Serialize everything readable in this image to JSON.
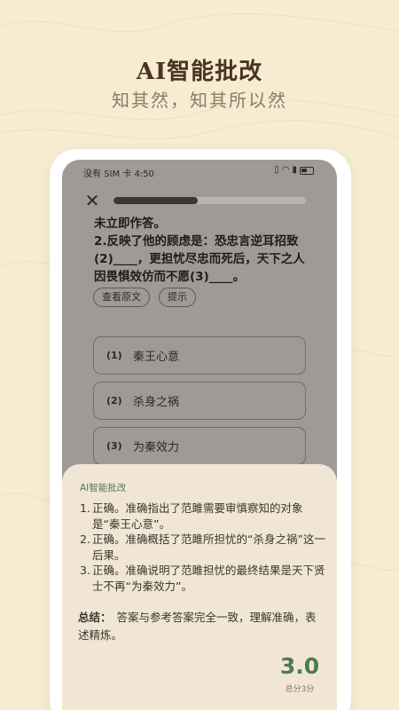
{
  "promo": {
    "title": "AI智能批改",
    "subtitle": "知其然，知其所以然"
  },
  "status_bar": {
    "left": "没有 SIM 卡 4:50",
    "icons": [
      "vibrate-icon",
      "wifi-icon",
      "battery-saver-icon",
      "battery-icon"
    ]
  },
  "quiz": {
    "progress_fraction": 0.44,
    "question_text": "未立即作答。\n2.反映了他的顾虑是：恐忠言逆耳招致(2)____，更担忧尽忠而死后，天下之人因畏惧效仿而不愿(3)____。",
    "view_original_label": "查看原文",
    "hint_label": "提示",
    "options": [
      {
        "num": "(1)",
        "text": "秦王心意"
      },
      {
        "num": "(2)",
        "text": "杀身之祸"
      },
      {
        "num": "(3)",
        "text": "为秦效力"
      }
    ]
  },
  "review": {
    "title": "AI智能批改",
    "items": [
      {
        "n": "1.",
        "text": "正确。准确指出了范雎需要审慎察知的对象是“秦王心意”。"
      },
      {
        "n": "2.",
        "text": "正确。准确概括了范雎所担忧的“杀身之祸”这一后果。"
      },
      {
        "n": "3.",
        "text": "正确。准确说明了范雎担忧的最终结果是天下贤士不再“为秦效力”。"
      }
    ],
    "summary_label": "总结：",
    "summary_text": "答案与参考答案完全一致，理解准确，表述精炼。",
    "score": "3.0",
    "score_total": "总分3分"
  },
  "colors": {
    "background": "#f7ecd2",
    "accent_green": "#4f7a52",
    "sheet": "#f1e6d3"
  }
}
